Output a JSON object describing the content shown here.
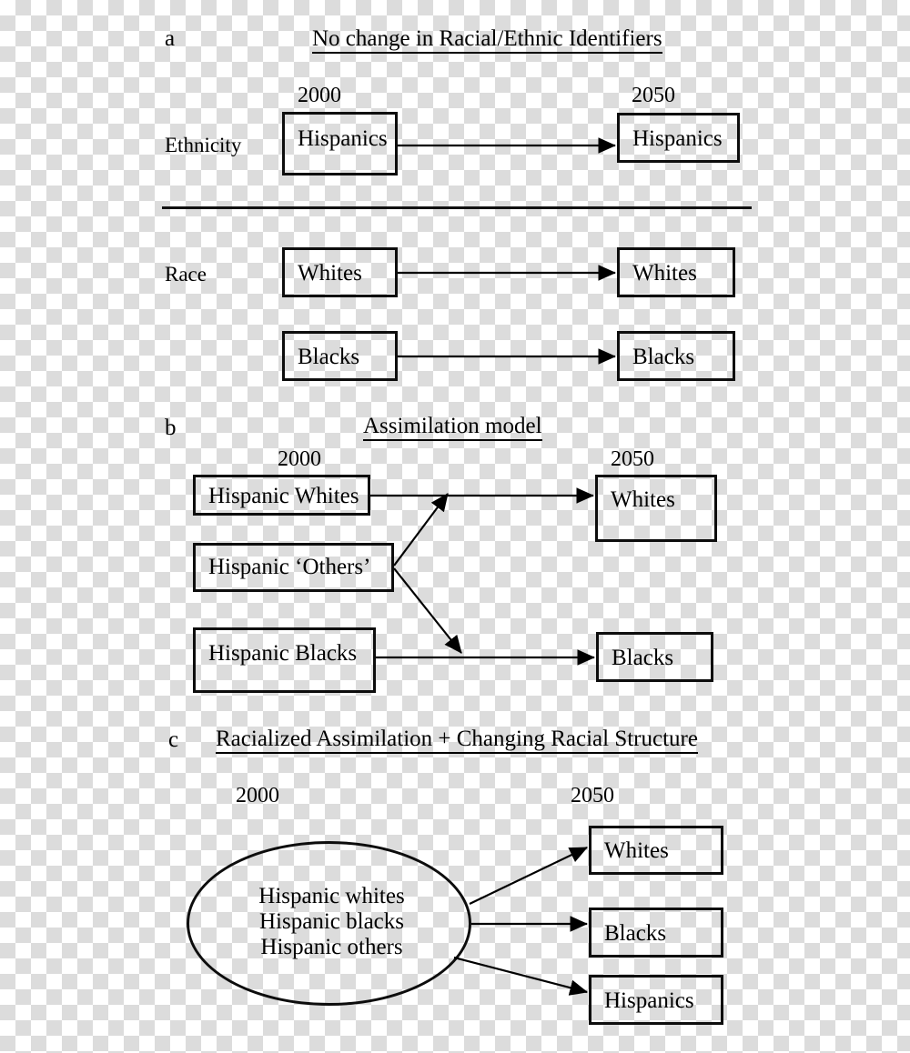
{
  "figure": {
    "background": "transparent-checkerboard",
    "ink_color": "#000000"
  },
  "panels": [
    {
      "letter": "a",
      "title": "No change in Racial/Ethnic Identifiers",
      "year_left": "2000",
      "year_right": "2050",
      "row_labels": [
        "Ethnicity",
        "Race"
      ],
      "left_nodes": [
        "Hispanics",
        "Whites",
        "Blacks"
      ],
      "right_nodes": [
        "Hispanics",
        "Whites",
        "Blacks"
      ],
      "edges": [
        {
          "from": "Hispanics",
          "to": "Hispanics"
        },
        {
          "from": "Whites",
          "to": "Whites"
        },
        {
          "from": "Blacks",
          "to": "Blacks"
        }
      ]
    },
    {
      "letter": "b",
      "title": "Assimilation model",
      "year_left": "2000",
      "year_right": "2050",
      "left_nodes": [
        "Hispanic Whites",
        "Hispanic ‘Others’",
        "Hispanic Blacks"
      ],
      "right_nodes": [
        "Whites",
        "Blacks"
      ],
      "edges": [
        {
          "from": "Hispanic Whites",
          "to": "Whites"
        },
        {
          "from": "Hispanic ‘Others’",
          "to": "Whites"
        },
        {
          "from": "Hispanic ‘Others’",
          "to": "Blacks"
        },
        {
          "from": "Hispanic Blacks",
          "to": "Blacks"
        }
      ]
    },
    {
      "letter": "c",
      "title": "Racialized Assimilation + Changing Racial Structure",
      "year_left": "2000",
      "year_right": "2050",
      "source_group": [
        "Hispanic whites",
        "Hispanic blacks",
        "Hispanic others"
      ],
      "right_nodes": [
        "Whites",
        "Blacks",
        "Hispanics"
      ],
      "edges": [
        {
          "from": "source_group",
          "to": "Whites"
        },
        {
          "from": "source_group",
          "to": "Blacks"
        },
        {
          "from": "source_group",
          "to": "Hispanics"
        }
      ]
    }
  ]
}
